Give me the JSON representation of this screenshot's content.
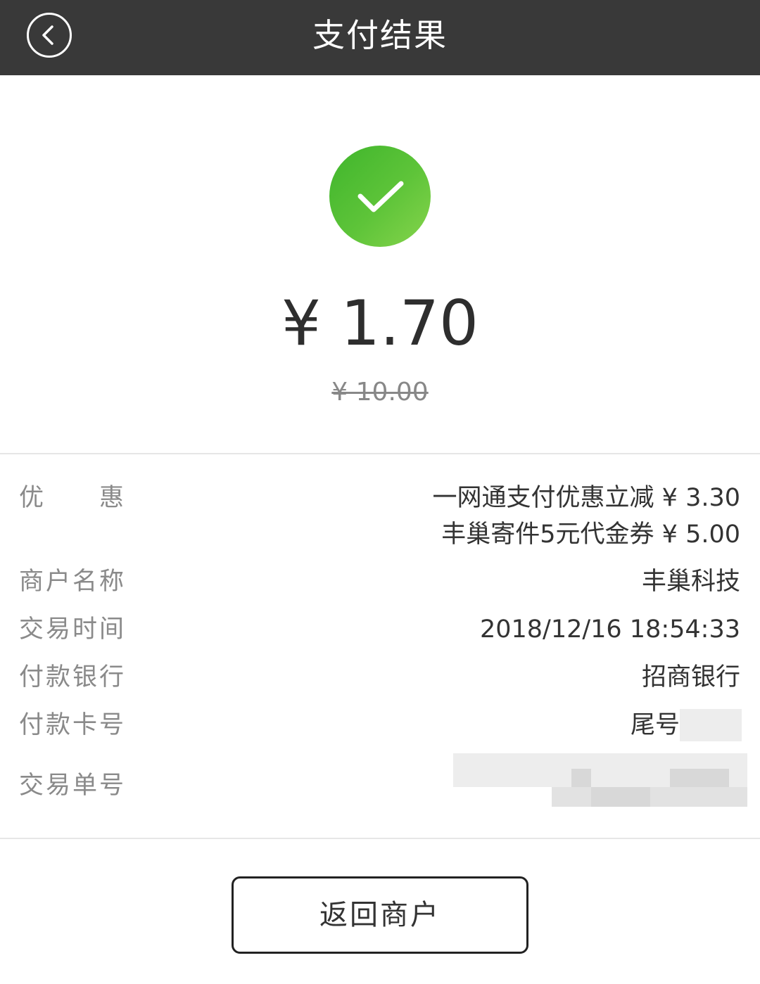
{
  "navbar": {
    "title": "支付结果"
  },
  "icons": {
    "back": "chevron-left-circle-icon",
    "success": "check-circle-icon"
  },
  "colors": {
    "navbar_bg": "#393939",
    "success_green": "#52be35"
  },
  "payment": {
    "amount": "¥ 1.70",
    "original_amount": "¥ 10.00"
  },
  "details": {
    "discount": {
      "label_chars": [
        "优",
        "惠"
      ],
      "lines": [
        "一网通支付优惠立减 ¥ 3.30",
        "丰巢寄件5元代金券 ¥ 5.00"
      ]
    },
    "merchant": {
      "label": "商户名称",
      "value": "丰巢科技"
    },
    "time": {
      "label": "交易时间",
      "value": "2018/12/16 18:54:33"
    },
    "bank": {
      "label": "付款银行",
      "value": "招商银行"
    },
    "card": {
      "label": "付款卡号",
      "value": "尾号"
    },
    "order": {
      "label": "交易单号"
    }
  },
  "actions": {
    "return_label": "返回商户"
  }
}
